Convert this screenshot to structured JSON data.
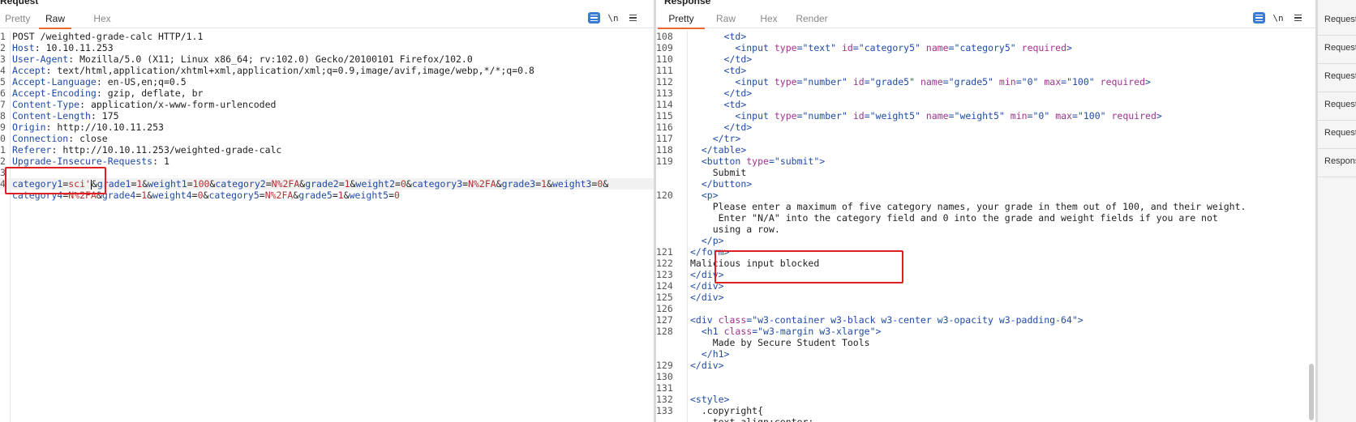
{
  "request": {
    "title": "Request",
    "tabs": [
      "Pretty",
      "Raw",
      "Hex"
    ],
    "active_tab": "Raw",
    "toolbar": {
      "wrap_icon": "wrap-lines-icon",
      "newline_label": "\\n",
      "menu_icon": "menu-icon"
    },
    "lines": [
      {
        "n": "1",
        "t": "POST /weighted-grade-calc HTTP/1.1"
      },
      {
        "n": "2",
        "k": "Host",
        "v": "10.10.11.253"
      },
      {
        "n": "3",
        "k": "User-Agent",
        "v": "Mozilla/5.0 (X11; Linux x86_64; rv:102.0) Gecko/20100101 Firefox/102.0"
      },
      {
        "n": "4",
        "k": "Accept",
        "v": "text/html,application/xhtml+xml,application/xml;q=0.9,image/avif,image/webp,*/*;q=0.8"
      },
      {
        "n": "5",
        "k": "Accept-Language",
        "v": "en-US,en;q=0.5"
      },
      {
        "n": "6",
        "k": "Accept-Encoding",
        "v": "gzip, deflate, br"
      },
      {
        "n": "7",
        "k": "Content-Type",
        "v": "application/x-www-form-urlencoded"
      },
      {
        "n": "8",
        "k": "Content-Length",
        "v": "175"
      },
      {
        "n": "9",
        "k": "Origin",
        "v": "http://10.10.11.253"
      },
      {
        "n": "0",
        "k": "Connection",
        "v": "close"
      },
      {
        "n": "1",
        "k": "Referer",
        "v": "http://10.10.11.253/weighted-grade-calc"
      },
      {
        "n": "2",
        "k": "Upgrade-Insecure-Requests",
        "v": "1"
      },
      {
        "n": "3",
        "t": ""
      },
      {
        "n": "4",
        "body1": true
      },
      {
        "n": "",
        "body2": true
      }
    ],
    "body1": [
      [
        "k",
        "category1"
      ],
      [
        "p",
        "="
      ],
      [
        "v",
        "sci'"
      ],
      [
        "p",
        "&"
      ],
      [
        "k",
        "grade1"
      ],
      [
        "p",
        "="
      ],
      [
        "v",
        "1"
      ],
      [
        "p",
        "&"
      ],
      [
        "k",
        "weight1"
      ],
      [
        "p",
        "="
      ],
      [
        "v",
        "100"
      ],
      [
        "p",
        "&"
      ],
      [
        "k",
        "category2"
      ],
      [
        "p",
        "="
      ],
      [
        "v",
        "N%2FA"
      ],
      [
        "p",
        "&"
      ],
      [
        "k",
        "grade2"
      ],
      [
        "p",
        "="
      ],
      [
        "v",
        "1"
      ],
      [
        "p",
        "&"
      ],
      [
        "k",
        "weight2"
      ],
      [
        "p",
        "="
      ],
      [
        "v",
        "0"
      ],
      [
        "p",
        "&"
      ],
      [
        "k",
        "category3"
      ],
      [
        "p",
        "="
      ],
      [
        "v",
        "N%2FA"
      ],
      [
        "p",
        "&"
      ],
      [
        "k",
        "grade3"
      ],
      [
        "p",
        "="
      ],
      [
        "v",
        "1"
      ],
      [
        "p",
        "&"
      ],
      [
        "k",
        "weight3"
      ],
      [
        "p",
        "="
      ],
      [
        "v",
        "0"
      ],
      [
        "p",
        "&"
      ]
    ],
    "body2": [
      [
        "k",
        "category4"
      ],
      [
        "p",
        "="
      ],
      [
        "v",
        "N%2FA"
      ],
      [
        "p",
        "&"
      ],
      [
        "k",
        "grade4"
      ],
      [
        "p",
        "="
      ],
      [
        "v",
        "1"
      ],
      [
        "p",
        "&"
      ],
      [
        "k",
        "weight4"
      ],
      [
        "p",
        "="
      ],
      [
        "v",
        "0"
      ],
      [
        "p",
        "&"
      ],
      [
        "k",
        "category5"
      ],
      [
        "p",
        "="
      ],
      [
        "v",
        "N%2FA"
      ],
      [
        "p",
        "&"
      ],
      [
        "k",
        "grade5"
      ],
      [
        "p",
        "="
      ],
      [
        "v",
        "1"
      ],
      [
        "p",
        "&"
      ],
      [
        "k",
        "weight5"
      ],
      [
        "p",
        "="
      ],
      [
        "v",
        "0"
      ]
    ]
  },
  "response": {
    "title": "Response",
    "tabs": [
      "Pretty",
      "Raw",
      "Hex",
      "Render"
    ],
    "active_tab": "Pretty",
    "toolbar": {
      "wrap_icon": "wrap-lines-icon",
      "newline_label": "\\n",
      "menu_icon": "menu-icon"
    },
    "lines": [
      {
        "n": "108",
        "i": "      ",
        "p": [
          [
            "t",
            "<td>"
          ]
        ]
      },
      {
        "n": "109",
        "i": "        ",
        "p": [
          [
            "t",
            "<input "
          ],
          [
            "a",
            "type"
          ],
          [
            "t",
            "="
          ],
          [
            "s",
            "\"text\""
          ],
          [
            "t",
            " "
          ],
          [
            "a",
            "id"
          ],
          [
            "t",
            "="
          ],
          [
            "s",
            "\"category5\""
          ],
          [
            "t",
            " "
          ],
          [
            "a",
            "name"
          ],
          [
            "t",
            "="
          ],
          [
            "s",
            "\"category5\""
          ],
          [
            "t",
            " "
          ],
          [
            "a",
            "required"
          ],
          [
            "t",
            ">"
          ]
        ]
      },
      {
        "n": "110",
        "i": "      ",
        "p": [
          [
            "t",
            "</td>"
          ]
        ]
      },
      {
        "n": "111",
        "i": "      ",
        "p": [
          [
            "t",
            "<td>"
          ]
        ]
      },
      {
        "n": "112",
        "i": "        ",
        "p": [
          [
            "t",
            "<input "
          ],
          [
            "a",
            "type"
          ],
          [
            "t",
            "="
          ],
          [
            "s",
            "\"number\""
          ],
          [
            "t",
            " "
          ],
          [
            "a",
            "id"
          ],
          [
            "t",
            "="
          ],
          [
            "s",
            "\"grade5\""
          ],
          [
            "t",
            " "
          ],
          [
            "a",
            "name"
          ],
          [
            "t",
            "="
          ],
          [
            "s",
            "\"grade5\""
          ],
          [
            "t",
            " "
          ],
          [
            "a",
            "min"
          ],
          [
            "t",
            "="
          ],
          [
            "s",
            "\"0\""
          ],
          [
            "t",
            " "
          ],
          [
            "a",
            "max"
          ],
          [
            "t",
            "="
          ],
          [
            "s",
            "\"100\""
          ],
          [
            "t",
            " "
          ],
          [
            "a",
            "required"
          ],
          [
            "t",
            ">"
          ]
        ]
      },
      {
        "n": "113",
        "i": "      ",
        "p": [
          [
            "t",
            "</td>"
          ]
        ]
      },
      {
        "n": "114",
        "i": "      ",
        "p": [
          [
            "t",
            "<td>"
          ]
        ]
      },
      {
        "n": "115",
        "i": "        ",
        "p": [
          [
            "t",
            "<input "
          ],
          [
            "a",
            "type"
          ],
          [
            "t",
            "="
          ],
          [
            "s",
            "\"number\""
          ],
          [
            "t",
            " "
          ],
          [
            "a",
            "id"
          ],
          [
            "t",
            "="
          ],
          [
            "s",
            "\"weight5\""
          ],
          [
            "t",
            " "
          ],
          [
            "a",
            "name"
          ],
          [
            "t",
            "="
          ],
          [
            "s",
            "\"weight5\""
          ],
          [
            "t",
            " "
          ],
          [
            "a",
            "min"
          ],
          [
            "t",
            "="
          ],
          [
            "s",
            "\"0\""
          ],
          [
            "t",
            " "
          ],
          [
            "a",
            "max"
          ],
          [
            "t",
            "="
          ],
          [
            "s",
            "\"100\""
          ],
          [
            "t",
            " "
          ],
          [
            "a",
            "required"
          ],
          [
            "t",
            ">"
          ]
        ]
      },
      {
        "n": "116",
        "i": "      ",
        "p": [
          [
            "t",
            "</td>"
          ]
        ]
      },
      {
        "n": "117",
        "i": "    ",
        "p": [
          [
            "t",
            "</tr>"
          ]
        ]
      },
      {
        "n": "118",
        "i": "  ",
        "p": [
          [
            "t",
            "</table>"
          ]
        ]
      },
      {
        "n": "119",
        "i": "  ",
        "p": [
          [
            "t",
            "<button "
          ],
          [
            "a",
            "type"
          ],
          [
            "t",
            "="
          ],
          [
            "s",
            "\"submit\""
          ],
          [
            "t",
            ">"
          ]
        ]
      },
      {
        "n": "",
        "i": "    ",
        "p": [
          [
            "x",
            "Submit"
          ]
        ]
      },
      {
        "n": "",
        "i": "  ",
        "p": [
          [
            "t",
            "</button>"
          ]
        ]
      },
      {
        "n": "120",
        "i": "  ",
        "p": [
          [
            "t",
            "<p>"
          ]
        ]
      },
      {
        "n": "",
        "i": "    ",
        "p": [
          [
            "x",
            "Please enter a maximum of five category names, your grade in them out of 100, and their weight."
          ]
        ]
      },
      {
        "n": "",
        "i": "     ",
        "p": [
          [
            "x",
            "Enter \"N/A\" into the category field and 0 into the grade and weight fields if you are not"
          ]
        ]
      },
      {
        "n": "",
        "i": "    ",
        "p": [
          [
            "x",
            "using a row."
          ]
        ]
      },
      {
        "n": "",
        "i": "  ",
        "p": [
          [
            "t",
            "</p>"
          ]
        ]
      },
      {
        "n": "121",
        "i": "",
        "p": [
          [
            "t",
            "</form>"
          ]
        ]
      },
      {
        "n": "122",
        "i": "",
        "p": [
          [
            "x",
            "Malicious input blocked"
          ]
        ]
      },
      {
        "n": "123",
        "i": "",
        "p": [
          [
            "t",
            "</div>"
          ]
        ]
      },
      {
        "n": "124",
        "i": "",
        "p": [
          [
            "t",
            "</div>"
          ]
        ]
      },
      {
        "n": "125",
        "i": "",
        "p": [
          [
            "t",
            "</div>"
          ]
        ]
      },
      {
        "n": "126",
        "i": "",
        "p": []
      },
      {
        "n": "127",
        "i": "",
        "p": [
          [
            "t",
            "<div "
          ],
          [
            "a",
            "class"
          ],
          [
            "t",
            "="
          ],
          [
            "s",
            "\"w3-container w3-black w3-center w3-opacity w3-padding-64\""
          ],
          [
            "t",
            ">"
          ]
        ]
      },
      {
        "n": "128",
        "i": "  ",
        "p": [
          [
            "t",
            "<h1 "
          ],
          [
            "a",
            "class"
          ],
          [
            "t",
            "="
          ],
          [
            "s",
            "\"w3-margin w3-xlarge\""
          ],
          [
            "t",
            ">"
          ]
        ]
      },
      {
        "n": "",
        "i": "    ",
        "p": [
          [
            "x",
            "Made by Secure Student Tools"
          ]
        ]
      },
      {
        "n": "",
        "i": "  ",
        "p": [
          [
            "t",
            "</h1>"
          ]
        ]
      },
      {
        "n": "129",
        "i": "",
        "p": [
          [
            "t",
            "</div>"
          ]
        ]
      },
      {
        "n": "130",
        "i": "",
        "p": []
      },
      {
        "n": "131",
        "i": "",
        "p": []
      },
      {
        "n": "132",
        "i": "",
        "p": [
          [
            "t",
            "<style>"
          ]
        ]
      },
      {
        "n": "133",
        "i": "  ",
        "p": [
          [
            "x",
            ".copyright{"
          ]
        ]
      },
      {
        "n": "",
        "i": "    ",
        "p": [
          [
            "x",
            "text-align:center;"
          ]
        ]
      },
      {
        "n": "",
        "i": "  ",
        "p": [
          [
            "x",
            "}"
          ]
        ]
      }
    ]
  },
  "side_panel": {
    "items": [
      "Request",
      "Request",
      "Request",
      "Request",
      "Request",
      "Response"
    ]
  }
}
